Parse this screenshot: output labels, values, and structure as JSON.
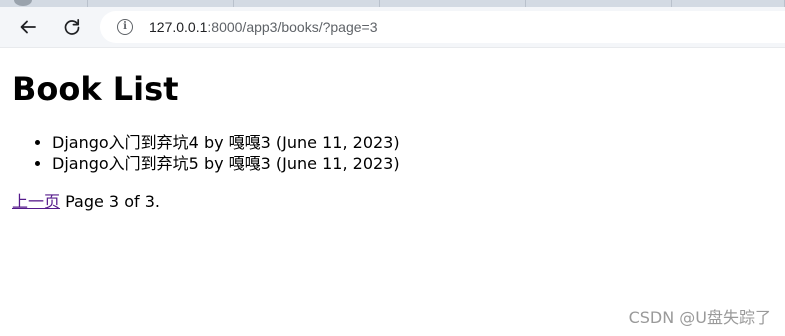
{
  "browser": {
    "url_host": "127.0.0.1",
    "url_rest": ":8000/app3/books/?page=3",
    "icons": {
      "back": "back-arrow-icon",
      "reload": "reload-icon",
      "site_info": "info-icon"
    }
  },
  "page": {
    "heading": "Book List",
    "books": [
      {
        "title": "Django入门到弃坑4",
        "author": "嘎嘎3",
        "date": "June 11, 2023"
      },
      {
        "title": "Django入门到弃坑5",
        "author": "嘎嘎3",
        "date": "June 11, 2023"
      }
    ],
    "by_word": "by",
    "pagination": {
      "previous_label": "上一页",
      "status": "Page 3 of 3."
    }
  },
  "watermark": "CSDN @U盘失踪了",
  "colors": {
    "visited_link": "#551a8b",
    "toolbar_bg": "#f4f6f9",
    "tabstrip_bg": "#d3dae3",
    "watermark": "#9a9a9a"
  }
}
